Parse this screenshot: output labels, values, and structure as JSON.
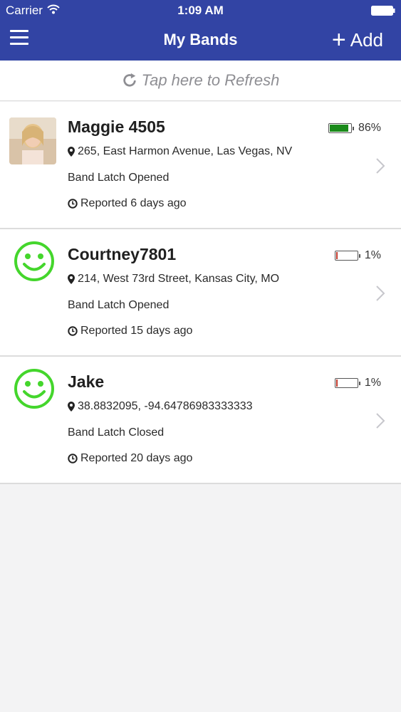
{
  "status_bar": {
    "carrier": "Carrier",
    "time": "1:09 AM"
  },
  "nav": {
    "title": "My Bands",
    "add_label": "Add"
  },
  "refresh": {
    "label": "Tap here to Refresh"
  },
  "colors": {
    "nav_bg": "#3244a4",
    "battery_high": "#1a8a1a",
    "battery_low": "#c0392b",
    "smiley": "#44d62c"
  },
  "bands": [
    {
      "name": "Maggie 4505",
      "avatar": "photo",
      "battery_percent": 86,
      "battery_label": "86%",
      "location": "265, East Harmon Avenue, Las Vegas, NV",
      "latch": "Band Latch Opened",
      "reported": "Reported 6 days ago"
    },
    {
      "name": "Courtney7801",
      "avatar": "smiley-icon",
      "battery_percent": 1,
      "battery_label": "1%",
      "location": "214, West 73rd Street, Kansas City, MO",
      "latch": "Band Latch Opened",
      "reported": "Reported 15 days ago"
    },
    {
      "name": "Jake",
      "avatar": "smiley-icon",
      "battery_percent": 1,
      "battery_label": "1%",
      "location": "38.8832095, -94.64786983333333",
      "latch": "Band Latch Closed",
      "reported": "Reported 20 days ago"
    }
  ]
}
